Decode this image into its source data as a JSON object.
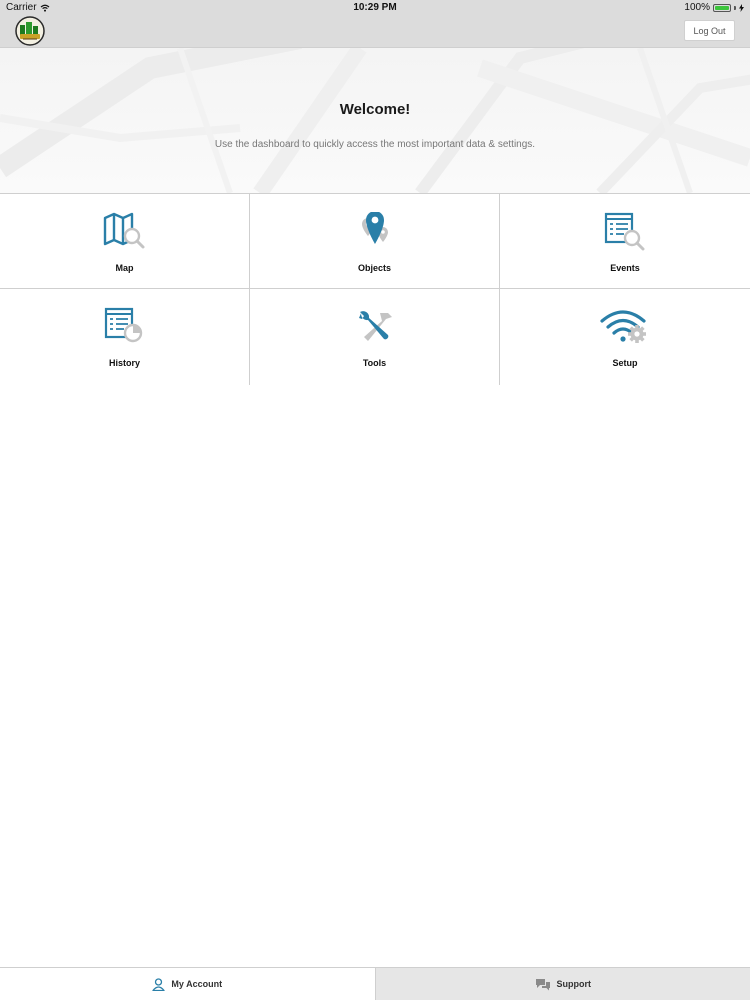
{
  "status_bar": {
    "carrier": "Carrier",
    "time": "10:29 PM",
    "battery": "100%",
    "battery_level": 1.0
  },
  "nav": {
    "logout_label": "Log Out"
  },
  "hero": {
    "title": "Welcome!",
    "subtitle": "Use the dashboard to quickly access the most important data & settings."
  },
  "tiles": [
    {
      "label": "Map",
      "icon": "map-search-icon"
    },
    {
      "label": "Objects",
      "icon": "location-pins-icon"
    },
    {
      "label": "Events",
      "icon": "document-search-icon"
    },
    {
      "label": "History",
      "icon": "document-clock-icon"
    },
    {
      "label": "Tools",
      "icon": "wrench-hammer-icon"
    },
    {
      "label": "Setup",
      "icon": "wifi-gear-icon"
    }
  ],
  "tabs": {
    "account_label": "My Account",
    "support_label": "Support"
  },
  "colors": {
    "accent": "#2a7fa8",
    "icon_gray": "#c4c4c4",
    "bar_bg": "#dcdcdc"
  }
}
